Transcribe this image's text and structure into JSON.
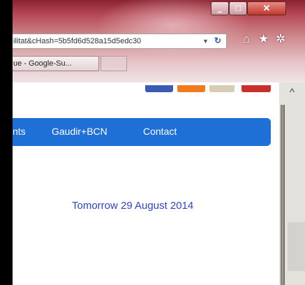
{
  "browser": {
    "address_text": "ilitat&cHash=5b5fd6d528a15d5edc30",
    "tab_title": "ue - Google-Su...",
    "controls": {
      "minimize": "–",
      "maximize": "□",
      "close": "✕"
    },
    "icons": {
      "refresh": "refresh-icon",
      "home": "home-icon",
      "favorites": "star-icon",
      "tools": "gear-icon"
    }
  },
  "page": {
    "nav": {
      "items": [
        "nts",
        "Gaudir+BCN",
        "Contact"
      ]
    },
    "date_text": "Tomorrow 29 August 2014",
    "social_icons": [
      "facebook-icon",
      "rss-icon",
      "email-icon",
      "google-plus-icon"
    ]
  },
  "colors": {
    "nav_bg": "#1e6fd6",
    "date_text": "#2f43c9",
    "chrome": "#8a2230"
  }
}
